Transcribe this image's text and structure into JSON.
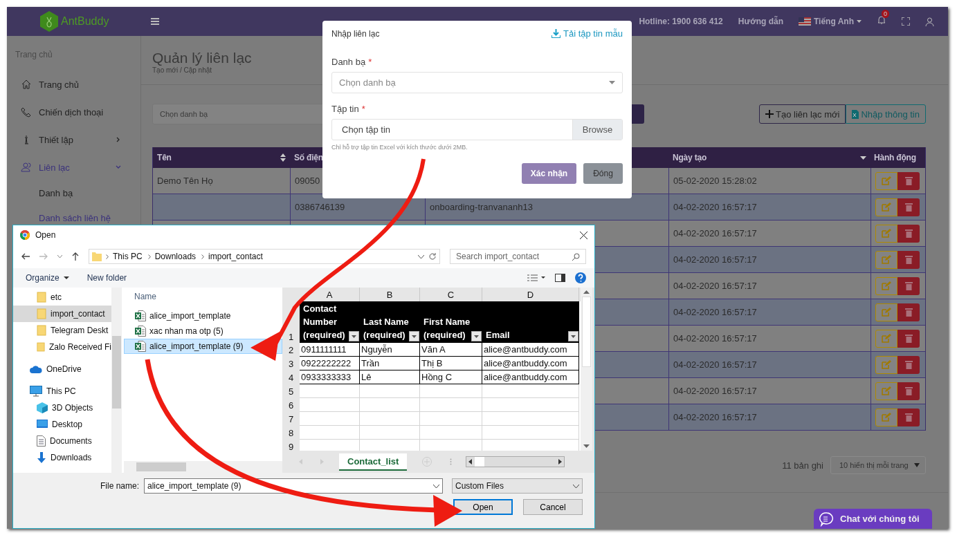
{
  "topbar": {
    "logo": "AntBuddy",
    "hotline": "Hotline: 1900 636 412",
    "guide": "Hướng dẫn",
    "language": "Tiếng Anh",
    "notifications": "0"
  },
  "sidebar": {
    "section": "Trang chủ",
    "items": [
      {
        "label": "Trang chủ",
        "kind": "home",
        "selected": false
      },
      {
        "label": "Chiến dịch thoại",
        "kind": "phone",
        "selected": false
      },
      {
        "label": "Thiết lập",
        "kind": "settings",
        "selected": false,
        "expanded": false
      },
      {
        "label": "Liên lạc",
        "kind": "contacts",
        "selected": true,
        "expanded": true,
        "children": [
          {
            "label": "Danh bạ",
            "selected": false
          },
          {
            "label": "Danh sách liên hệ",
            "selected": true
          }
        ]
      }
    ]
  },
  "page": {
    "title": "Quản lý liên lạc",
    "breadcrumb": "Tạo mới / Cập nhật",
    "filter": {
      "placeholder": "Chọn danh bạ"
    },
    "actions": [
      {
        "label": "Tạo liên lạc mới",
        "kind": "add"
      },
      {
        "label": "Nhập thông tin",
        "kind": "import"
      }
    ]
  },
  "table": {
    "headers": {
      "name": "Tên",
      "phone": "Số điện",
      "created": "Ngày tạo",
      "actions": "Hành động"
    },
    "rows": [
      {
        "name": "Demo Tên Họ",
        "phone": "09050",
        "created": "05-02-2020 15:28:02"
      },
      {
        "phone": "0386746139",
        "group": "onboarding-tranvananh13",
        "created": "04-02-2020 16:57:17"
      },
      {
        "created": "04-02-2020 16:57:17"
      },
      {
        "created": "04-02-2020 16:57:17"
      },
      {
        "created": "04-02-2020 16:57:17"
      },
      {
        "created": "04-02-2020 16:57:17"
      },
      {
        "created": "04-02-2020 16:57:17"
      },
      {
        "created": "04-02-2020 16:57:17"
      },
      {
        "created": "04-02-2020 16:57:17"
      },
      {
        "created": "04-02-2020 16:57:17"
      }
    ]
  },
  "pagination": {
    "total": "11 bản ghi",
    "page_size": "10 hiển thị mỗi trang"
  },
  "chat": "Chat với chúng tôi",
  "modal": {
    "title": "Nhập liên lạc",
    "template_link": "Tải tập tin mẫu",
    "contact_list": {
      "label": "Danh bạ",
      "required": "*",
      "placeholder": "Chọn danh bạ"
    },
    "file": {
      "label": "Tập tin",
      "required": "*",
      "placeholder": "Chọn tập tin",
      "browse": "Browse"
    },
    "hint": "Chỉ hỗ trợ tập tin Excel với kích thước dưới 2MB.",
    "confirm": "Xác nhận",
    "close": "Đóng"
  },
  "file_dialog": {
    "title": "Open",
    "path": [
      "This PC",
      "Downloads",
      "import_contact"
    ],
    "search": {
      "placeholder": "Search import_contact"
    },
    "organize": "Organize",
    "new_folder": "New folder",
    "nav": [
      {
        "label": "etc",
        "kind": "folder",
        "selected": false
      },
      {
        "label": "import_contact",
        "kind": "folder",
        "selected": true
      },
      {
        "label": "Telegram Deskt",
        "kind": "folder",
        "selected": false
      },
      {
        "label": "Zalo Received Fi",
        "kind": "folder",
        "selected": false
      },
      {
        "label": "OneDrive",
        "kind": "cloud",
        "selected": false
      },
      {
        "label": "This PC",
        "kind": "pc",
        "selected": false
      },
      {
        "label": "3D Objects",
        "kind": "cube",
        "selected": false
      },
      {
        "label": "Desktop",
        "kind": "desktop",
        "selected": false
      },
      {
        "label": "Documents",
        "kind": "document",
        "selected": false
      },
      {
        "label": "Downloads",
        "kind": "download",
        "selected": false
      }
    ],
    "name_header": "Name",
    "files": [
      {
        "name": "alice_import_template",
        "selected": false
      },
      {
        "name": "xac nhan ma otp (5)",
        "selected": false
      },
      {
        "name": "alice_import_template (9)",
        "selected": true
      }
    ],
    "preview": {
      "columns": [
        "A",
        "B",
        "C",
        "D"
      ],
      "header_row": {
        "number": "1",
        "cells": [
          "Contact Number (required)",
          "Last Name (required)",
          "First Name (required)",
          "Email"
        ]
      },
      "rows": [
        {
          "number": "2",
          "cells": [
            "0911111111",
            "Nguyễn",
            "Văn A",
            "alice@antbuddy.com"
          ]
        },
        {
          "number": "3",
          "cells": [
            "0922222222",
            "Trần",
            "Thị B",
            "alice@antbuddy.com"
          ]
        },
        {
          "number": "4",
          "cells": [
            "0933333333",
            "Lê",
            "Hồng C",
            "alice@antbuddy.com"
          ]
        },
        {
          "number": "5",
          "cells": []
        },
        {
          "number": "6",
          "cells": []
        },
        {
          "number": "7",
          "cells": []
        },
        {
          "number": "8",
          "cells": []
        },
        {
          "number": "9",
          "cells": []
        }
      ],
      "sheet": "Contact_list"
    },
    "file_name_label": "File name:",
    "file_name": "alice_import_template (9)",
    "file_type": "Custom Files",
    "open": "Open",
    "cancel": "Cancel"
  }
}
